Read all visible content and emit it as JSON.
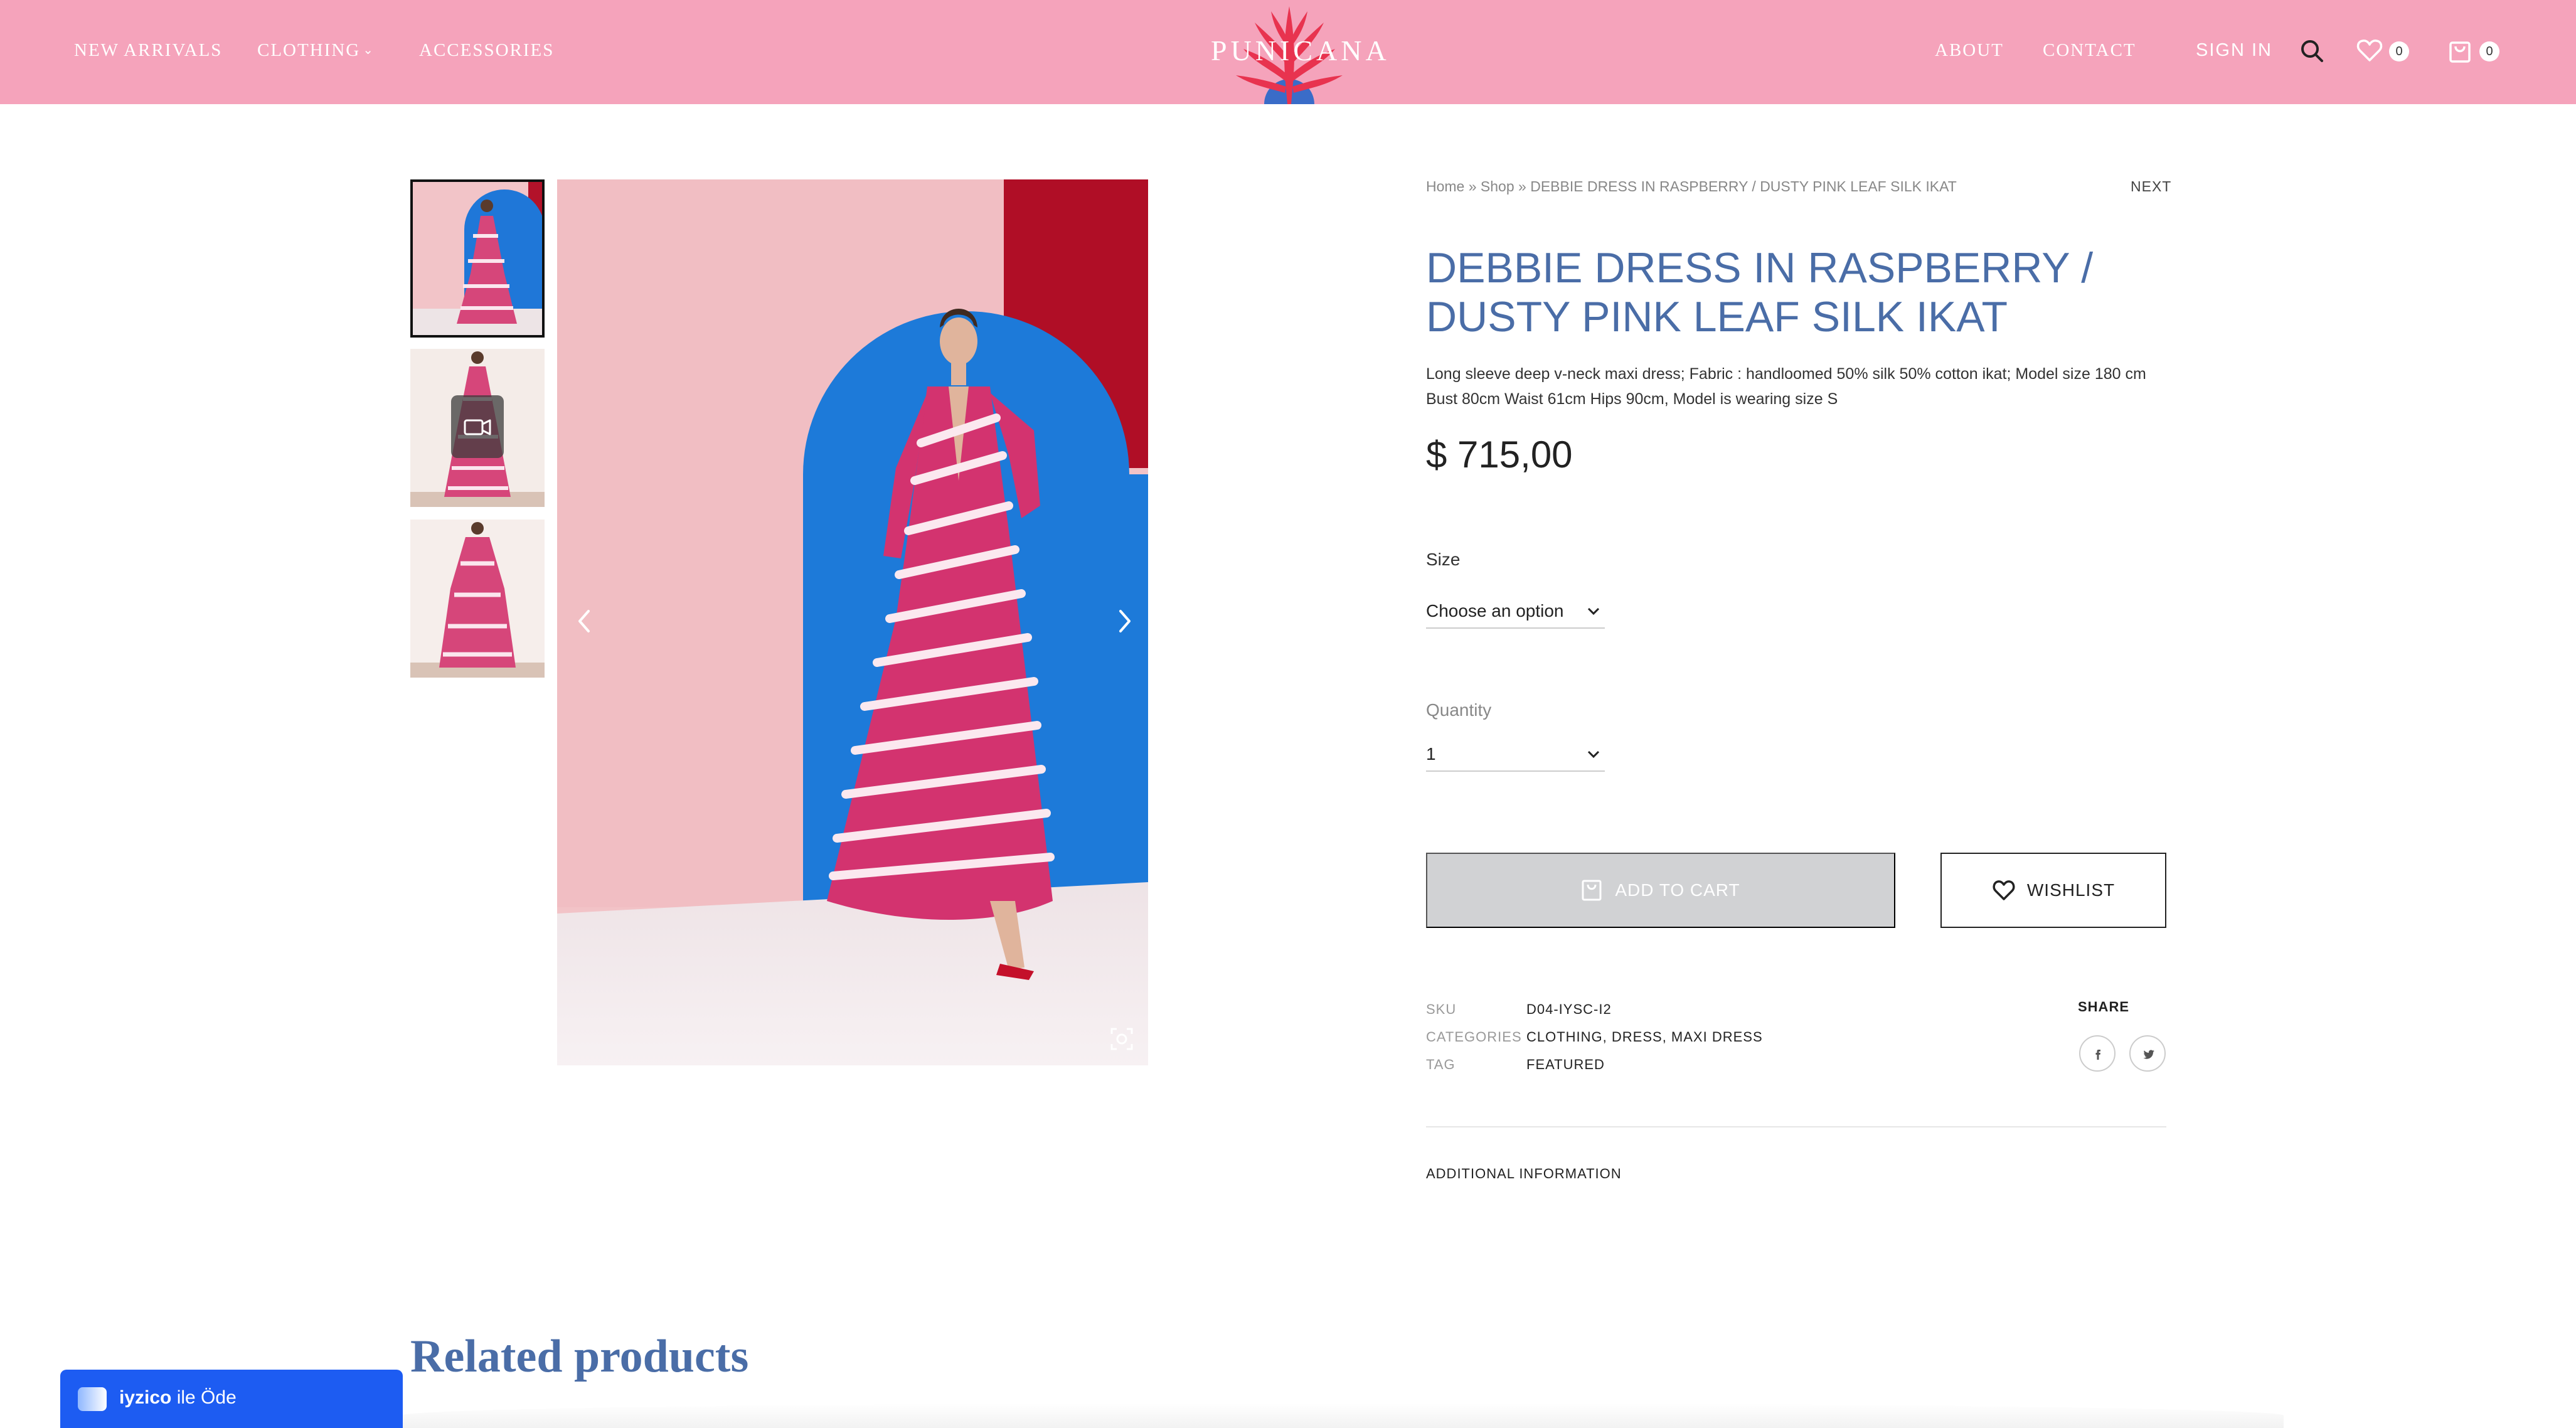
{
  "header": {
    "nav_left": [
      "NEW ARRIVALS",
      "CLOTHING",
      "ACCESSORIES"
    ],
    "clothing_chevron": "⌄",
    "logo_text": "PUNICANA",
    "nav_right": [
      "ABOUT",
      "CONTACT",
      "SIGN IN"
    ],
    "wishlist_count": "0",
    "cart_count": "0",
    "icons": [
      "search-icon",
      "heart-icon",
      "cart-icon"
    ],
    "colors": {
      "bar": "#f5a3bb",
      "logo_red": "#e8334f",
      "logo_blue": "#3a6cc8"
    }
  },
  "gallery": {
    "thumbnails": [
      "thumbnail-1",
      "thumbnail-2-video",
      "thumbnail-3"
    ],
    "active_thumbnail": 1,
    "icons": [
      "video-camera-icon",
      "arrow-left-icon",
      "arrow-right-icon",
      "zoom-icon"
    ]
  },
  "product": {
    "breadcrumb": "Home » Shop » DEBBIE DRESS IN RASPBERRY / DUSTY PINK LEAF SILK IKAT",
    "next_label": "NEXT",
    "title": "DEBBIE DRESS IN RASPBERRY / DUSTY PINK LEAF SILK IKAT",
    "description": "Long sleeve deep v-neck maxi dress; Fabric : handloomed 50% silk 50% cotton ikat; Model size 180 cm Bust 80cm Waist 61cm Hips 90cm, Model is wearing size S",
    "price": "$ 715,00",
    "size_label": "Size",
    "size_value": "Choose an option",
    "quantity_label": "Quantity",
    "quantity_value": "1",
    "add_to_cart_label": "ADD TO CART",
    "wishlist_label": "WISHLIST",
    "meta": {
      "sku_label": "SKU",
      "sku": "D04-IYSC-I2",
      "categories_label": "CATEGORIES",
      "categories": "CLOTHING, DRESS, MAXI DRESS",
      "tag_label": "TAG",
      "tag": "FEATURED"
    },
    "share_label": "SHARE",
    "share_icons": [
      "facebook-icon",
      "twitter-icon"
    ],
    "tab_label": "ADDITIONAL INFORMATION",
    "colors": {
      "title": "#4a6da7",
      "button_disabled": "#d1d2d4"
    }
  },
  "related": {
    "title": "Related products"
  },
  "payment_widget": {
    "brand": "iyzico",
    "suffix": " ile Öde",
    "color": "#1d5cf2"
  }
}
